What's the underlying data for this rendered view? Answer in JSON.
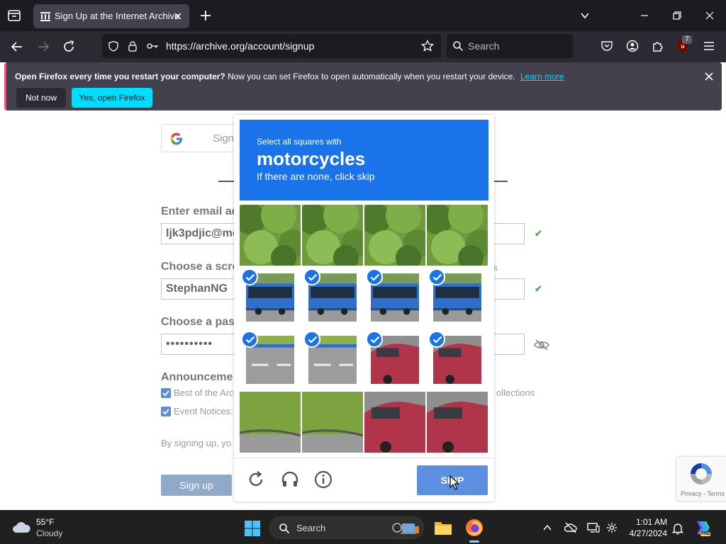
{
  "browser": {
    "tab_title": "Sign Up at the Internet Archive",
    "url": "https://archive.org/account/signup",
    "search_placeholder": "Search",
    "ublock_count": "7"
  },
  "notification": {
    "bold": "Open Firefox every time you restart your computer?",
    "text": "Now you can set Firefox to open automatically when you restart your device.",
    "link": "Learn more",
    "btn_not_now": "Not now",
    "btn_yes": "Yes, open Firefox"
  },
  "form": {
    "google_label": "Sign",
    "email_label": "Enter email ad",
    "email_value": "ljk3pdjic@me",
    "screenname_label": "Choose a scre",
    "screenname_value": "StephanNG",
    "screenname_helper": "s",
    "password_label": "Choose a pas",
    "password_value": "••••••••••",
    "announcements_title": "Announceme",
    "cb1_label": "Best of the Arc",
    "cb1_suffix": "ollections",
    "cb2_label": "Event Notices:",
    "legal_text": "By signing up, yo",
    "signup_button": "Sign up",
    "check_mark": "✔"
  },
  "captcha": {
    "instruction_small": "Select all squares with",
    "target_object": "motorcycles",
    "instruction_sub": "If there are none, click skip",
    "skip_button": "SKIP",
    "cells": [
      {
        "index": 0,
        "scene": "trees",
        "selected": false
      },
      {
        "index": 1,
        "scene": "trees",
        "selected": false
      },
      {
        "index": 2,
        "scene": "trees",
        "selected": false
      },
      {
        "index": 3,
        "scene": "trees",
        "selected": false
      },
      {
        "index": 4,
        "scene": "bus",
        "selected": true
      },
      {
        "index": 5,
        "scene": "bus",
        "selected": true
      },
      {
        "index": 6,
        "scene": "bus",
        "selected": true
      },
      {
        "index": 7,
        "scene": "bus",
        "selected": true
      },
      {
        "index": 8,
        "scene": "road",
        "selected": true
      },
      {
        "index": 9,
        "scene": "road",
        "selected": true
      },
      {
        "index": 10,
        "scene": "car",
        "selected": true
      },
      {
        "index": 11,
        "scene": "car",
        "selected": true
      },
      {
        "index": 12,
        "scene": "grass",
        "selected": false
      },
      {
        "index": 13,
        "scene": "grass",
        "selected": false
      },
      {
        "index": 14,
        "scene": "car",
        "selected": false
      },
      {
        "index": 15,
        "scene": "car",
        "selected": false
      }
    ],
    "accent": "#1a73e8"
  },
  "recaptcha_badge": {
    "links": "Privacy - Terms"
  },
  "taskbar": {
    "weather_temp": "55°F",
    "weather_cond": "Cloudy",
    "search_label": "Search",
    "time": "1:01 AM",
    "date": "4/27/2024",
    "copilot_badge": "PRE"
  },
  "icons": [
    "tab-list-icon",
    "archive-favicon-icon",
    "close-icon",
    "plus-icon",
    "chevron-down-icon",
    "minimize-icon",
    "maximize-icon",
    "back-icon",
    "forward-icon",
    "reload-icon",
    "shield-icon",
    "lock-icon",
    "permissions-icon",
    "star-icon",
    "search-icon",
    "pocket-icon",
    "account-icon",
    "extensions-icon",
    "ublock-icon",
    "hamburger-menu-icon",
    "google-logo-icon",
    "eye-icon",
    "refresh-icon",
    "headphones-icon",
    "info-icon",
    "cursor-icon",
    "recaptcha-logo-icon",
    "weather-cloud-icon",
    "windows-start-icon",
    "file-explorer-icon",
    "firefox-icon",
    "tray-chevron-icon",
    "onedrive-icon",
    "display-icon",
    "settings-icon",
    "bell-icon",
    "copilot-icon"
  ]
}
